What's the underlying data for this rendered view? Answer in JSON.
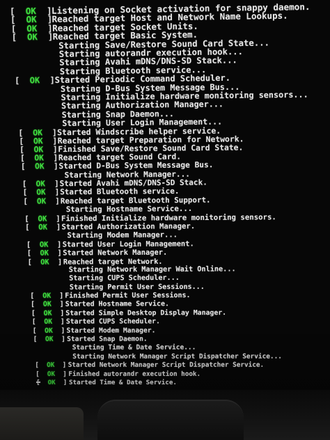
{
  "console": {
    "ok_label": "OK",
    "bracket_open": "[",
    "bracket_close": "]",
    "lines": [
      {
        "status": "ok",
        "text": "Listening on Socket activation for snappy daemon."
      },
      {
        "status": "ok",
        "text": "Reached target Host and Network Name Lookups."
      },
      {
        "status": "ok",
        "text": "Reached target Socket Units."
      },
      {
        "status": "ok",
        "text": "Reached target Basic System."
      },
      {
        "status": "none",
        "text": "Starting Save/Restore Sound Card State..."
      },
      {
        "status": "none",
        "text": "Starting autorandr execution hook..."
      },
      {
        "status": "none",
        "text": "Starting Avahi mDNS/DNS-SD Stack..."
      },
      {
        "status": "none",
        "text": "Starting Bluetooth service..."
      },
      {
        "status": "ok",
        "text": "Started Periodic Command Scheduler."
      },
      {
        "status": "none",
        "text": "Starting D-Bus System Message Bus..."
      },
      {
        "status": "none",
        "text": "Starting Initialize hardware monitoring sensors..."
      },
      {
        "status": "none",
        "text": "Starting Authorization Manager..."
      },
      {
        "status": "none",
        "text": "Starting Snap Daemon..."
      },
      {
        "status": "none",
        "text": "Starting User Login Management..."
      },
      {
        "status": "ok",
        "text": "Started Windscribe helper service."
      },
      {
        "status": "ok",
        "text": "Reached target Preparation for Network."
      },
      {
        "status": "ok",
        "text": "Finished Save/Restore Sound Card State."
      },
      {
        "status": "ok",
        "text": "Reached target Sound Card."
      },
      {
        "status": "ok",
        "text": "Started D-Bus System Message Bus."
      },
      {
        "status": "none",
        "text": "Starting Network Manager..."
      },
      {
        "status": "ok",
        "text": "Started Avahi mDNS/DNS-SD Stack."
      },
      {
        "status": "ok",
        "text": "Started Bluetooth service."
      },
      {
        "status": "ok",
        "text": "Reached target Bluetooth Support."
      },
      {
        "status": "none",
        "text": "Starting Hostname Service..."
      },
      {
        "status": "ok",
        "text": "Finished Initialize hardware monitoring sensors."
      },
      {
        "status": "ok",
        "text": "Started Authorization Manager."
      },
      {
        "status": "none",
        "text": "Starting Modem Manager..."
      },
      {
        "status": "ok",
        "text": "Started User Login Management."
      },
      {
        "status": "ok",
        "text": "Started Network Manager."
      },
      {
        "status": "ok",
        "text": "Reached target Network."
      },
      {
        "status": "none",
        "text": "Starting Network Manager Wait Online..."
      },
      {
        "status": "none",
        "text": "Starting CUPS Scheduler..."
      },
      {
        "status": "none",
        "text": "Starting Permit User Sessions..."
      },
      {
        "status": "ok",
        "text": "Finished Permit User Sessions."
      },
      {
        "status": "ok",
        "text": "Started Hostname Service."
      },
      {
        "status": "ok",
        "text": "Started Simple Desktop Display Manager."
      },
      {
        "status": "ok",
        "text": "Started CUPS Scheduler."
      },
      {
        "status": "ok",
        "text": "Started Modem Manager."
      },
      {
        "status": "ok",
        "text": "Started Snap Daemon."
      },
      {
        "status": "none",
        "text": "Starting Time & Date Service..."
      },
      {
        "status": "none",
        "text": "Starting Network Manager Script Dispatcher Service..."
      },
      {
        "status": "ok",
        "text": "Started Network Manager Script Dispatcher Service."
      },
      {
        "status": "ok",
        "text": "Finished autorandr execution hook."
      },
      {
        "status": "ok",
        "text": "Started Time & Date Service."
      }
    ]
  },
  "colors": {
    "ok_green": "#3fe03f",
    "text_white": "#e6e6e6",
    "background": "#070707"
  }
}
